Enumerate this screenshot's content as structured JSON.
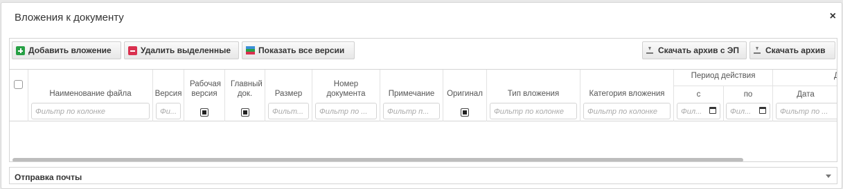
{
  "dialog": {
    "title": "Вложения к документу",
    "close_glyph": "×"
  },
  "toolbar": {
    "add_label": "Добавить вложение",
    "delete_label": "Удалить выделенные",
    "versions_label": "Показать все версии",
    "download_ep_label": "Скачать архив с ЭП",
    "download_label": "Скачать архив"
  },
  "grid": {
    "columns": {
      "filename": "Наименование файла",
      "version": "Версия",
      "working_version": "Рабочая версия",
      "main_doc": "Главный док.",
      "size": "Размер",
      "doc_number": "Номер документа",
      "note": "Примечание",
      "original": "Оригинал",
      "attachment_type": "Тип вложения",
      "attachment_category": "Категория вложения",
      "period": "Период действия",
      "period_from": "с",
      "period_to": "по",
      "date_group": "Д",
      "date": "Дата"
    },
    "filters": {
      "filename": "Фильтр по колонке",
      "version": "Фи...",
      "size": "Фильт...",
      "doc_number": "Фильтр по ...",
      "note": "Фильтр п...",
      "attachment_type": "Фильтр по колонке",
      "attachment_category": "Фильтр по колонке",
      "period_from": "Фил...",
      "period_to": "Фил...",
      "date": "Фильтр по ..."
    }
  },
  "mail_section": {
    "label": "Отправка почты"
  },
  "colors": {
    "add": "#27a045",
    "delete": "#d9304f"
  }
}
